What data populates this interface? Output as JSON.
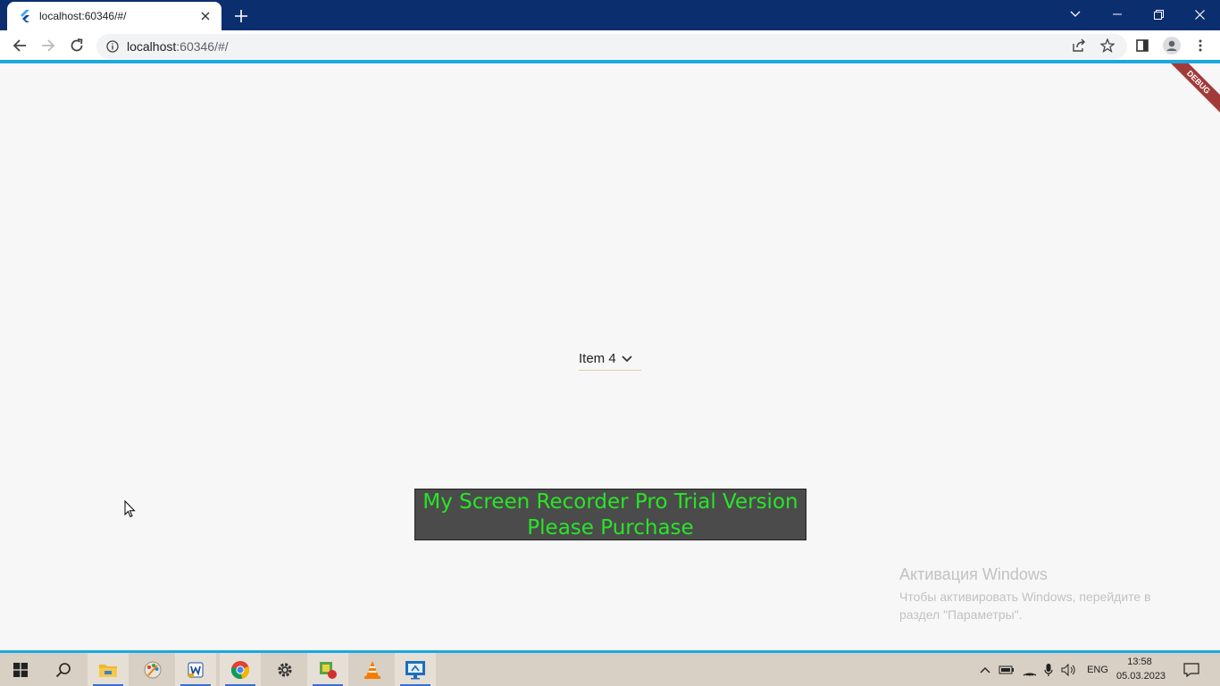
{
  "browser": {
    "tab_title": "localhost:60346/#/",
    "url_host": "localhost",
    "url_rest": ":60346/#/"
  },
  "app": {
    "debug_banner": "DEBUG",
    "dropdown_selected": "Item 4"
  },
  "overlay": {
    "watermark_line1": "My Screen Recorder Pro Trial Version",
    "watermark_line2": "Please Purchase",
    "activation_title": "Активация Windows",
    "activation_line1": "Чтобы активировать Windows, перейдите в",
    "activation_line2": "раздел \"Параметры\"."
  },
  "taskbar": {
    "language": "ENG",
    "time": "13:58",
    "date": "05.03.2023",
    "apps": [
      "windows-start",
      "search",
      "file-explorer",
      "paint-app",
      "word-app",
      "chrome",
      "settings",
      "game-app",
      "vlc",
      "remote-desktop"
    ]
  },
  "colors": {
    "tabstrip": "#0b2e6f",
    "accent_line": "#1ba8e0",
    "watermark_text": "#27e627",
    "watermark_bg": "#4b4b4b",
    "debug_banner": "#a33a3a"
  }
}
